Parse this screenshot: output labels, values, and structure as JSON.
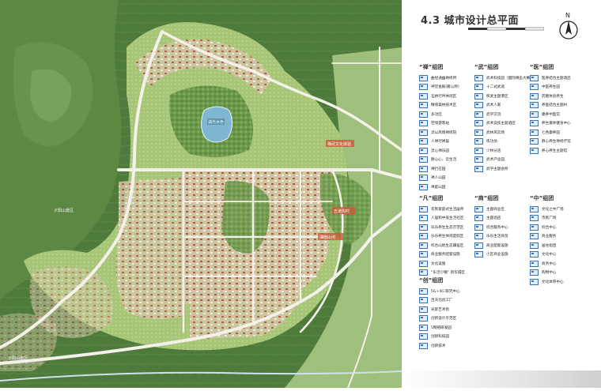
{
  "title": "4.3 城市设计总平面",
  "north": "N",
  "groups": [
    {
      "quote": "“禅”",
      "name": "组团",
      "items": [
        "曲径通幽禅修所",
        "神堂金殿(雁公所)",
        "石林行吟休闲区",
        "精修森林技术区",
        "多功区",
        "空境游客站",
        "灵山风情禅修院",
        "人禅行禅居",
        "灵心禅乐园",
        "静心心、云生活",
        "禅行庄园",
        "禅人山园",
        "禅庭山园"
      ]
    },
    {
      "quote": "“武”",
      "name": "组团",
      "items": [
        "武术科技园（国际搏击大赛）",
        "十二式武道",
        "练武主题港区",
        "武术人家",
        "武学交流",
        "武术竞技主题酒店",
        "武林风云场",
        "练功坊",
        "少林分店",
        "武术产业园",
        "武学主题会所"
      ]
    },
    {
      "quote": "“医”",
      "name": "组团",
      "items": [
        "医养结合主题酒店",
        "中医养生园",
        "药膳体验养生",
        "养医结合主题村",
        "康养中医馆",
        "养生康体健身中心",
        "七色康养园",
        "静心养生禅修疗馆",
        "养心养生主题馆"
      ]
    },
    {
      "quote": "“凡”",
      "name": "组团",
      "items": [
        "农民家庭式生活居所",
        "人居和中低生活社区",
        "乐乐养生生态示范区",
        "乐乐养生休闲度假区",
        "综合山地生态康居区",
        "商业服务配套设施",
        "文化设施",
        "“乐活小镇” 新华城区"
      ]
    },
    {
      "quote": "“商”",
      "name": "组团",
      "items": [
        "主题商业区",
        "主题酒店",
        "综合服务中心",
        "乐乐生活商贸",
        "商业配套设施",
        "小区商业设施"
      ]
    },
    {
      "quote": "“中”",
      "name": "组团",
      "items": [
        "文化之中广场",
        "市民广场",
        "综合中心",
        "商业服务",
        "居住组团",
        "文化中心",
        "商务中心",
        "购物中心",
        "文化体育中心"
      ]
    },
    {
      "quote": "“创”",
      "name": "组团",
      "items": [
        "5G+4G 研究中心",
        "吕天北创工厂",
        "光影艺术街",
        "创新设计示范区",
        "5网络研发园",
        "创新科技园",
        "创新技术"
      ]
    }
  ],
  "map_labels": {
    "lake": "湖光水色",
    "village_w": "夕阳山景区",
    "village_sw": "夕阳山景区",
    "school": "禅武文化体验",
    "area_e": "五道沟村",
    "park": "湘南山河"
  }
}
